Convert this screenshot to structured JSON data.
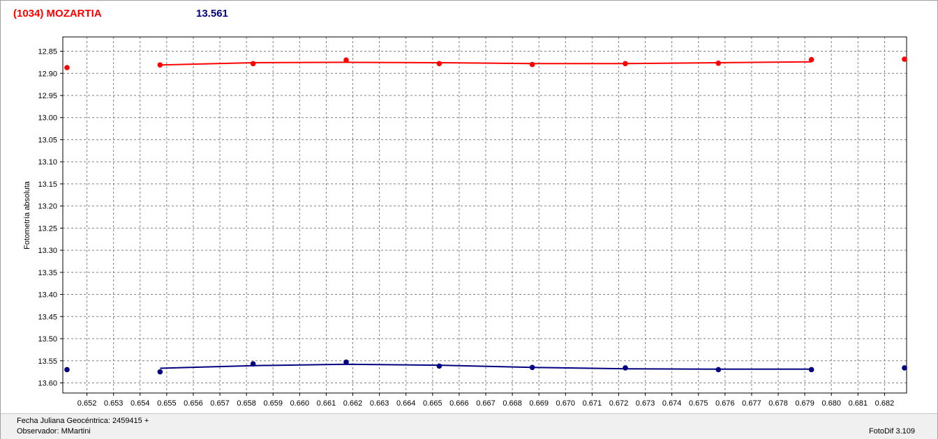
{
  "header": {
    "asteroid": "(1034) MOZARTIA",
    "magnitude": "13.561"
  },
  "footer": {
    "date_label": "Fecha Juliana Geocéntrica: 2459415 +",
    "observer_label": "Observador: MMartini",
    "software": "FotoDif 3.109"
  },
  "colors": {
    "series_red": "#ff0000",
    "series_blue": "#000080"
  },
  "chart_data": {
    "type": "scatter",
    "title": "",
    "xlabel": "",
    "ylabel": "Fotometría absoluta",
    "xlim": [
      0.65125,
      0.68275
    ],
    "ylim": [
      12.835,
      13.615
    ],
    "y_inverted": true,
    "grid": true,
    "x_ticks": [
      "0.652",
      "0.653",
      "0.654",
      "0.655",
      "0.656",
      "0.657",
      "0.658",
      "0.659",
      "0.660",
      "0.661",
      "0.662",
      "0.663",
      "0.664",
      "0.665",
      "0.666",
      "0.667",
      "0.668",
      "0.669",
      "0.670",
      "0.671",
      "0.672",
      "0.673",
      "0.674",
      "0.675",
      "0.676",
      "0.677",
      "0.678",
      "0.679",
      "0.680",
      "0.681",
      "0.682"
    ],
    "y_ticks": [
      "12.85",
      "12.90",
      "12.95",
      "13.00",
      "13.05",
      "13.10",
      "13.15",
      "13.20",
      "13.25",
      "13.30",
      "13.35",
      "13.40",
      "13.45",
      "13.50",
      "13.55",
      "13.60"
    ],
    "series": [
      {
        "color": "#ff0000",
        "points": [
          {
            "x": 0.65125,
            "y": 12.887
          },
          {
            "x": 0.65475,
            "y": 12.881
          },
          {
            "x": 0.65825,
            "y": 12.878
          },
          {
            "x": 0.66175,
            "y": 12.87
          },
          {
            "x": 0.66525,
            "y": 12.878
          },
          {
            "x": 0.66875,
            "y": 12.88
          },
          {
            "x": 0.67225,
            "y": 12.878
          },
          {
            "x": 0.67575,
            "y": 12.877
          },
          {
            "x": 0.67925,
            "y": 12.869
          },
          {
            "x": 0.68275,
            "y": 12.868
          }
        ],
        "fit_line": [
          {
            "x": 0.65475,
            "y": 12.881
          },
          {
            "x": 0.65825,
            "y": 12.876
          },
          {
            "x": 0.66175,
            "y": 12.875
          },
          {
            "x": 0.66525,
            "y": 12.876
          },
          {
            "x": 0.66875,
            "y": 12.878
          },
          {
            "x": 0.67225,
            "y": 12.878
          },
          {
            "x": 0.67575,
            "y": 12.876
          },
          {
            "x": 0.67925,
            "y": 12.874
          }
        ]
      },
      {
        "color": "#000080",
        "points": [
          {
            "x": 0.65125,
            "y": 13.57
          },
          {
            "x": 0.65475,
            "y": 13.575
          },
          {
            "x": 0.65825,
            "y": 13.557
          },
          {
            "x": 0.66175,
            "y": 13.553
          },
          {
            "x": 0.66525,
            "y": 13.562
          },
          {
            "x": 0.66875,
            "y": 13.565
          },
          {
            "x": 0.67225,
            "y": 13.566
          },
          {
            "x": 0.67575,
            "y": 13.57
          },
          {
            "x": 0.67925,
            "y": 13.57
          },
          {
            "x": 0.68275,
            "y": 13.566
          }
        ],
        "fit_line": [
          {
            "x": 0.65475,
            "y": 13.567
          },
          {
            "x": 0.65825,
            "y": 13.561
          },
          {
            "x": 0.66175,
            "y": 13.558
          },
          {
            "x": 0.66525,
            "y": 13.56
          },
          {
            "x": 0.66875,
            "y": 13.565
          },
          {
            "x": 0.67225,
            "y": 13.568
          },
          {
            "x": 0.67575,
            "y": 13.569
          },
          {
            "x": 0.67925,
            "y": 13.569
          }
        ]
      }
    ]
  }
}
